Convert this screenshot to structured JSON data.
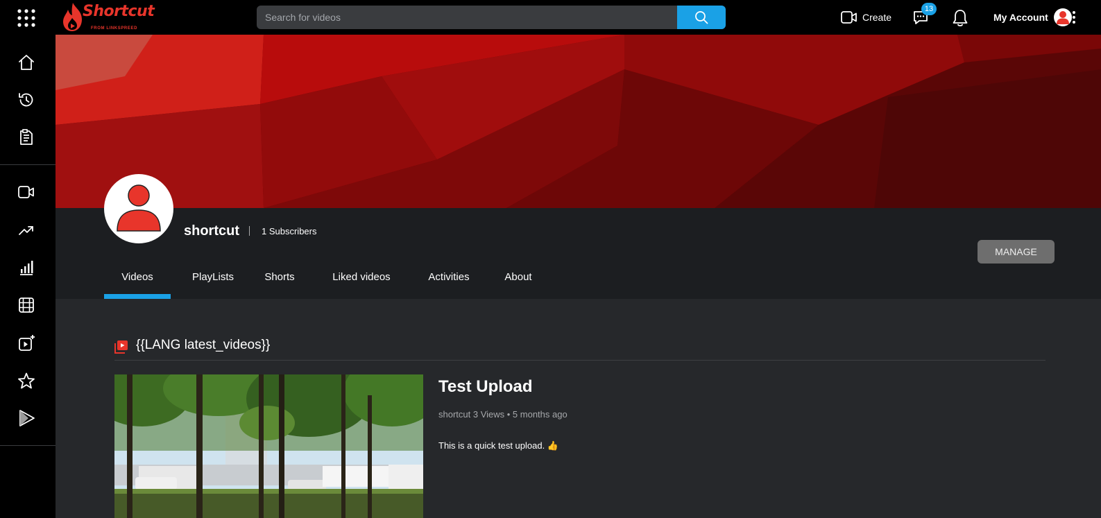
{
  "app": {
    "logo_text": "Shortcut",
    "logo_subtext": "FROM LINKSPREED"
  },
  "header": {
    "search_placeholder": "Search for videos",
    "create_label": "Create",
    "messages_badge": "13",
    "account_label": "My Account"
  },
  "sidebar": {
    "items": [
      "home-icon",
      "history-icon",
      "clipboard-icon",
      "video-camera-icon",
      "trending-icon",
      "stats-icon",
      "film-icon",
      "add-video-icon",
      "star-icon",
      "play-store-icon"
    ]
  },
  "channel": {
    "name": "shortcut",
    "subscribers": "1 Subscribers",
    "manage_label": "MANAGE",
    "tabs": [
      "Videos",
      "PlayLists",
      "Shorts",
      "Liked videos",
      "Activities",
      "About"
    ],
    "active_tab": "Videos"
  },
  "section": {
    "title": "{{LANG latest_videos}}"
  },
  "video": {
    "title": "Test Upload",
    "meta": "shortcut 3 Views • 5 months ago",
    "description": "This is a quick test upload. 👍"
  },
  "colors": {
    "accent": "#1aa1e6",
    "brand": "#e8352b",
    "background": "#26282b",
    "topbar": "#000000",
    "manage_button": "#6e6e6e"
  }
}
